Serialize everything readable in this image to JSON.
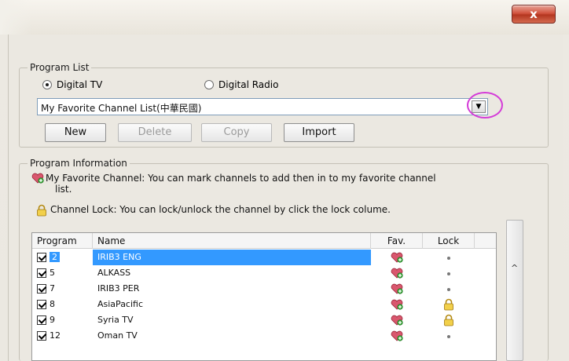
{
  "window": {
    "close_label": "x"
  },
  "program_list": {
    "title": "Program List",
    "radio_digital_tv": "Digital TV",
    "radio_digital_radio": "Digital Radio",
    "selected_radio": "Digital TV",
    "combo_value": "My Favorite Channel List(中華民國)",
    "buttons": {
      "new": "New",
      "delete": "Delete",
      "copy": "Copy",
      "import": "Import"
    }
  },
  "program_info": {
    "title": "Program Information",
    "fav_text_line1": "My Favorite Channel: You can mark channels to add then in to my favorite channel",
    "fav_text_line2": "list.",
    "lock_text": "Channel Lock: You can lock/unlock the channel by click the lock colume."
  },
  "table": {
    "columns": [
      "Program",
      "Name",
      "Fav.",
      "Lock"
    ],
    "rows": [
      {
        "program": "2",
        "name": "IRIB3 ENG",
        "fav": true,
        "lock": "dot",
        "selected": true
      },
      {
        "program": "5",
        "name": "ALKASS",
        "fav": true,
        "lock": "dot",
        "selected": false
      },
      {
        "program": "7",
        "name": "IRIB3 PER",
        "fav": true,
        "lock": "dot",
        "selected": false
      },
      {
        "program": "8",
        "name": "AsiaPacific",
        "fav": true,
        "lock": "locked",
        "selected": false
      },
      {
        "program": "9",
        "name": "Syria TV",
        "fav": true,
        "lock": "locked",
        "selected": false
      },
      {
        "program": "12",
        "name": "Oman TV",
        "fav": true,
        "lock": "dot",
        "selected": false
      }
    ]
  },
  "scrollbar": {
    "glyph": "^"
  },
  "colors": {
    "selection": "#3399ff",
    "highlight_circle": "#d43cd8",
    "close_button": "#c84a33"
  }
}
